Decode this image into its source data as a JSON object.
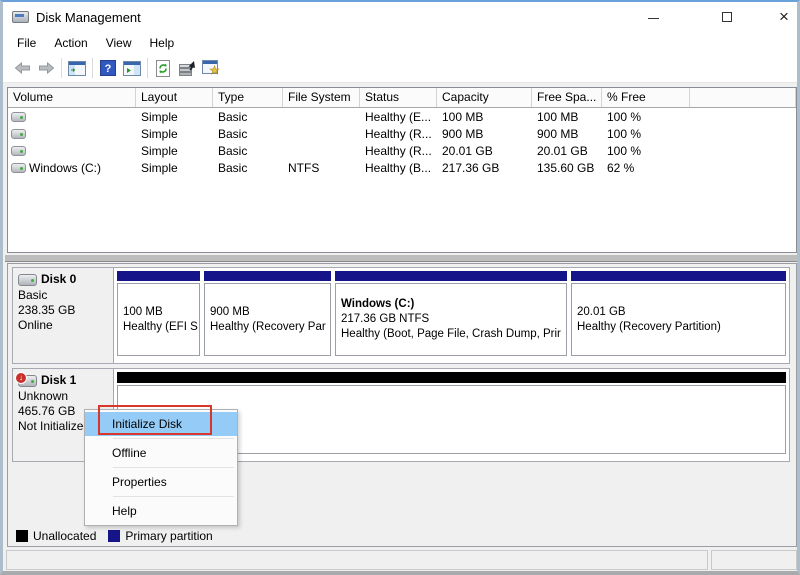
{
  "window": {
    "title": "Disk Management",
    "controls": [
      "minimize",
      "maximize",
      "close"
    ]
  },
  "menu_bar": {
    "items": [
      "File",
      "Action",
      "View",
      "Help"
    ]
  },
  "toolbar": {
    "icons": [
      "back",
      "forward",
      "show-console-tree",
      "help",
      "show-action-pane",
      "refresh",
      "disk-properties",
      "rescan-disks"
    ]
  },
  "volume_list": {
    "columns": [
      "Volume",
      "Layout",
      "Type",
      "File System",
      "Status",
      "Capacity",
      "Free Spa...",
      "% Free"
    ],
    "rows": [
      {
        "volume": "",
        "layout": "Simple",
        "type": "Basic",
        "file_system": "",
        "status": "Healthy (E...",
        "capacity": "100 MB",
        "free_space": "100 MB",
        "percent_free": "100 %"
      },
      {
        "volume": "",
        "layout": "Simple",
        "type": "Basic",
        "file_system": "",
        "status": "Healthy (R...",
        "capacity": "900 MB",
        "free_space": "900 MB",
        "percent_free": "100 %"
      },
      {
        "volume": "",
        "layout": "Simple",
        "type": "Basic",
        "file_system": "",
        "status": "Healthy (R...",
        "capacity": "20.01 GB",
        "free_space": "20.01 GB",
        "percent_free": "100 %"
      },
      {
        "volume": "Windows (C:)",
        "layout": "Simple",
        "type": "Basic",
        "file_system": "NTFS",
        "status": "Healthy (B...",
        "capacity": "217.36 GB",
        "free_space": "135.60 GB",
        "percent_free": "62 %"
      }
    ]
  },
  "disks": [
    {
      "name": "Disk 0",
      "type": "Basic",
      "size": "238.35 GB",
      "status": "Online",
      "partition_bar_color": "#151589",
      "partitions": [
        {
          "capacity": "100 MB",
          "status": "Healthy (EFI S"
        },
        {
          "capacity": "900 MB",
          "status": "Healthy (Recovery Par"
        },
        {
          "name": "Windows  (C:)",
          "capacity": "217.36 GB NTFS",
          "status": "Healthy (Boot, Page File, Crash Dump, Prir"
        },
        {
          "capacity": "20.01 GB",
          "status": "Healthy (Recovery Partition)"
        }
      ]
    },
    {
      "name": "Disk 1",
      "type": "Unknown",
      "size": "465.76 GB",
      "status": "Not Initialized",
      "unallocated_bar_color": "#000000"
    }
  ],
  "context_menu": {
    "highlight_color": "#94ccf7",
    "items": [
      "Initialize Disk",
      "Offline",
      "Properties",
      "Help"
    ]
  },
  "annotation": {
    "shape": "red-box",
    "around": "Initialize Disk",
    "color": "#d8372e"
  },
  "legend": {
    "items": [
      {
        "label": "Unallocated",
        "color": "#000000"
      },
      {
        "label": "Primary partition",
        "color": "#151589"
      }
    ]
  }
}
